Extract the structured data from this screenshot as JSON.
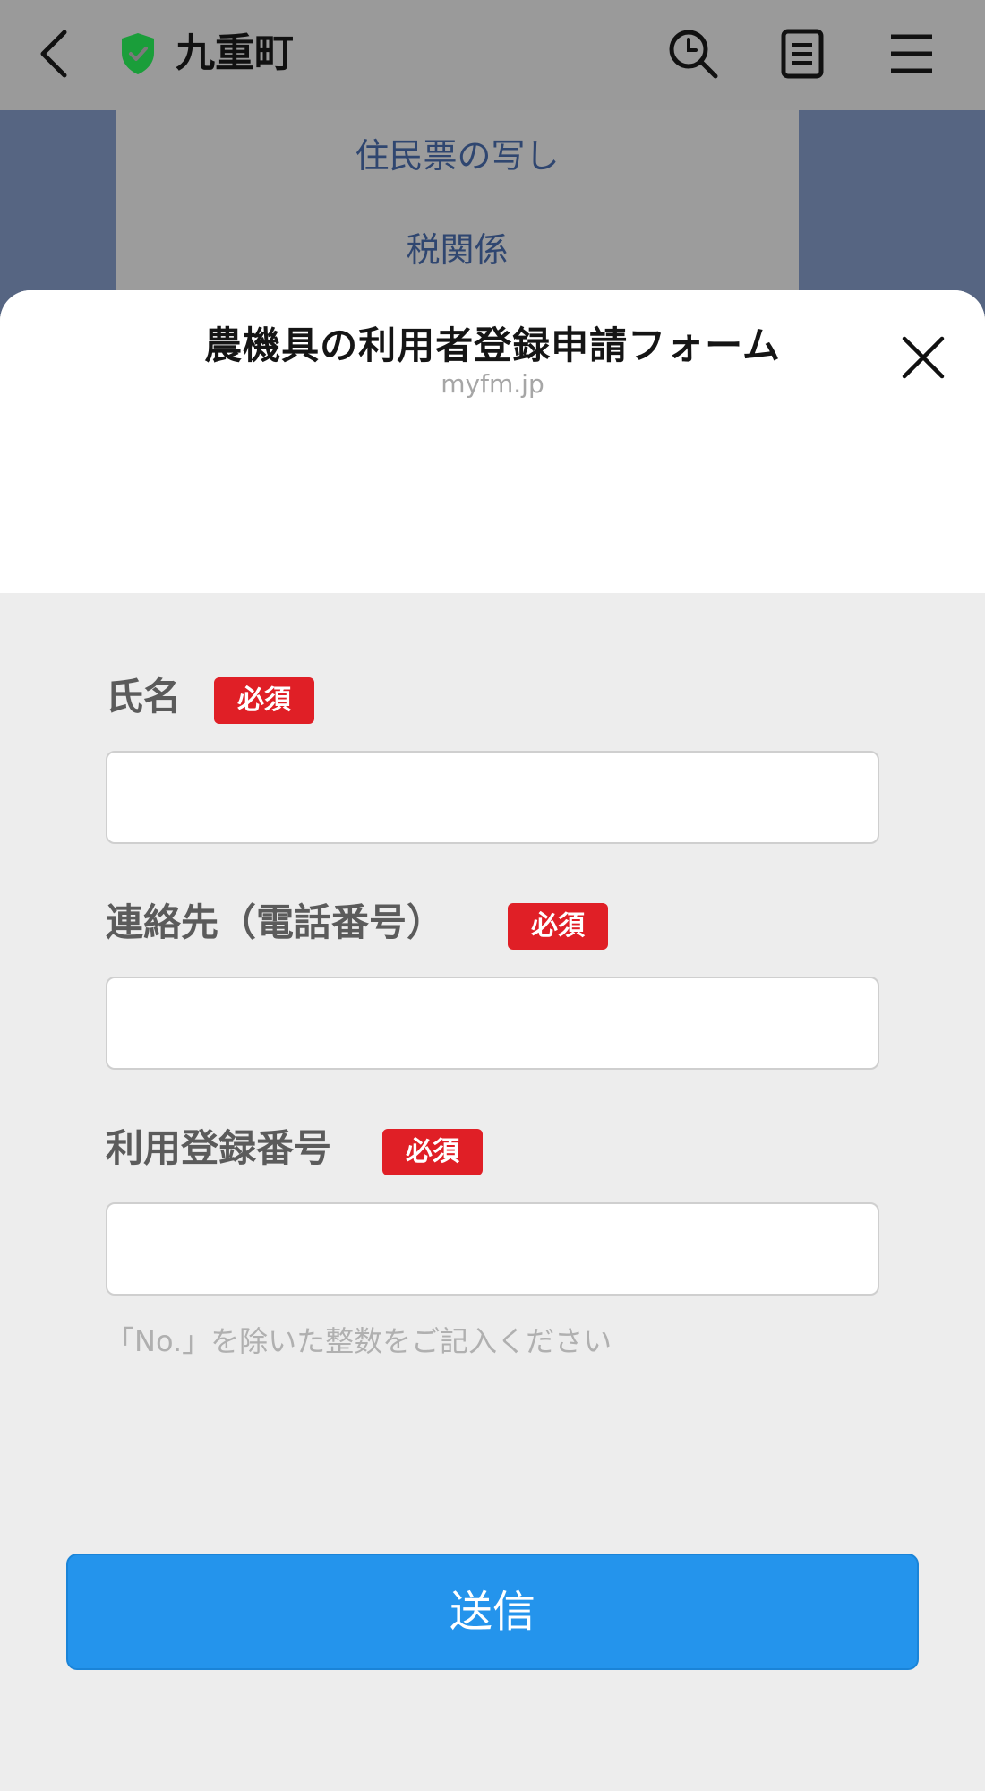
{
  "header": {
    "account_name": "九重町",
    "icons": [
      "back-icon",
      "verified-shield-icon",
      "search-icon",
      "note-icon",
      "menu-icon"
    ]
  },
  "background_menu": {
    "items": [
      "住民票の写し",
      "税関係"
    ]
  },
  "sheet": {
    "title": "農機具の利用者登録申請フォーム",
    "domain": "myfm.jp"
  },
  "form": {
    "fields": [
      {
        "label": "氏名",
        "required_badge": "必須",
        "value": ""
      },
      {
        "label": "連絡先（電話番号）",
        "required_badge": "必須",
        "value": ""
      },
      {
        "label": "利用登録番号",
        "required_badge": "必須",
        "value": ""
      }
    ],
    "hint": "「No.」を除いた整数をご記入ください",
    "submit_label": "送信"
  },
  "colors": {
    "required_badge": "#e01f26",
    "submit_button": "#2494ec",
    "shield": "#1a9e3a"
  }
}
